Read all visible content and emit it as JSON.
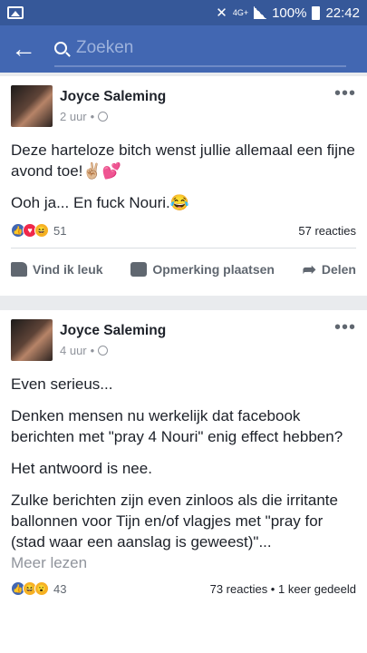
{
  "status_bar": {
    "network": "4G+",
    "battery_percent": "100%",
    "time": "22:42"
  },
  "top_bar": {
    "search_placeholder": "Zoeken"
  },
  "posts": [
    {
      "author": "Joyce Saleming",
      "time": "2 uur",
      "paragraphs": [
        "Deze harteloze bitch wenst jullie allemaal een fijne avond toe!✌🏼💕",
        "Ooh ja... En fuck Nouri.😂"
      ],
      "reaction_count": "51",
      "comments": "57 reacties",
      "actions": {
        "like": "Vind ik leuk",
        "comment": "Opmerking plaatsen",
        "share": "Delen"
      }
    },
    {
      "author": "Joyce Saleming",
      "time": "4 uur",
      "paragraphs": [
        "Even serieus...",
        "Denken mensen nu werkelijk dat facebook berichten met \"pray 4 Nouri\" enig effect hebben?",
        "Het antwoord is nee.",
        "Zulke berichten zijn even zinloos als die irritante ballonnen voor Tijn en/of vlagjes met \"pray for (stad waar een aanslag is geweest)\"..."
      ],
      "see_more": "Meer lezen",
      "reaction_count": "43",
      "comments": "73 reacties • 1 keer gedeeld"
    }
  ]
}
